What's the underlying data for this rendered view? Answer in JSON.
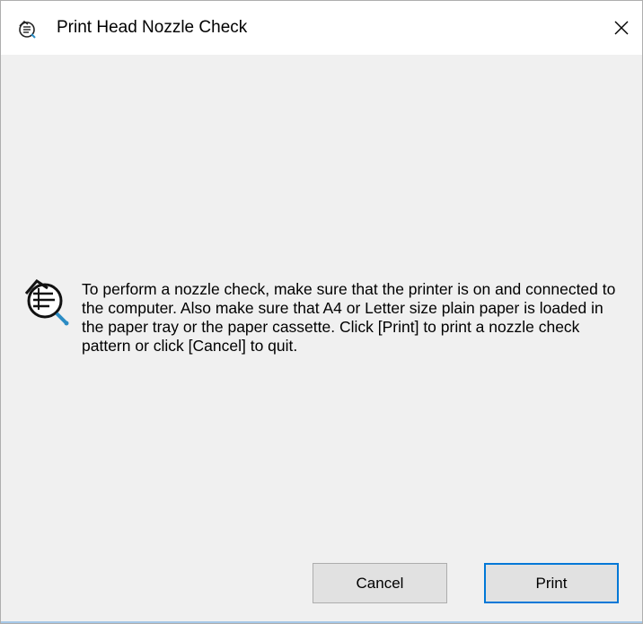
{
  "window": {
    "title": "Print Head Nozzle Check",
    "title_icon": "nozzle-check-icon",
    "close_icon": "close-icon"
  },
  "message": {
    "icon": "nozzle-check-icon",
    "text": "To perform a nozzle check, make sure that the printer is on and connected to the computer. Also make sure that A4 or Letter size plain paper is loaded in the paper tray or the paper cassette. Click [Print] to print a nozzle check pattern or click [Cancel] to quit."
  },
  "buttons": {
    "cancel_label": "Cancel",
    "print_label": "Print"
  },
  "colors": {
    "default_button_border": "#0078d7",
    "dialog_background": "#f0f0f0",
    "titlebar_background": "#ffffff"
  }
}
